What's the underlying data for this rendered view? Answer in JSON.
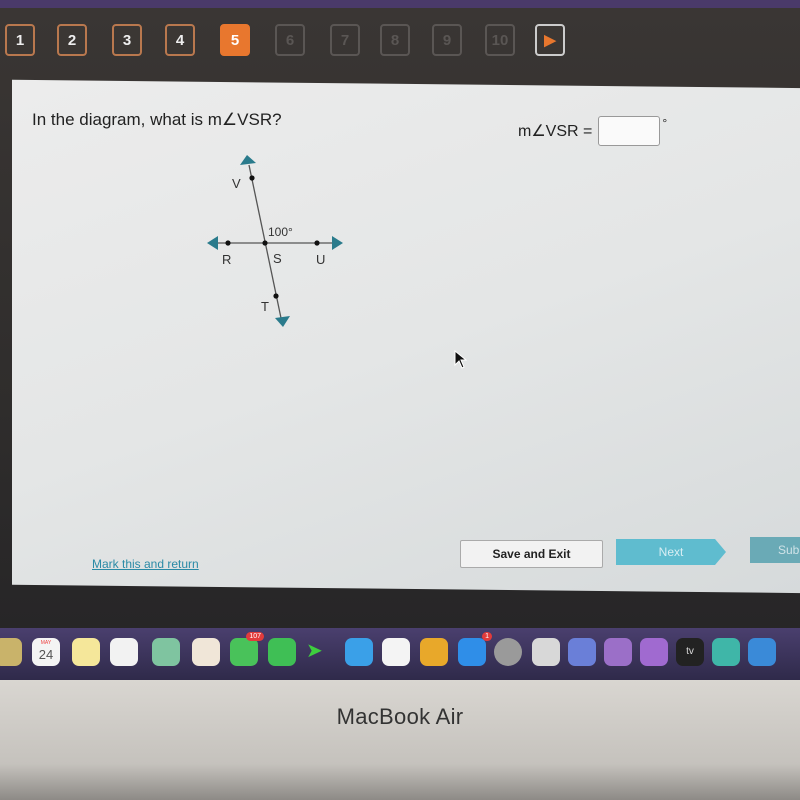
{
  "nav": {
    "questions": [
      {
        "label": "1",
        "state": "answered"
      },
      {
        "label": "2",
        "state": "answered"
      },
      {
        "label": "3",
        "state": "answered"
      },
      {
        "label": "4",
        "state": "answered"
      },
      {
        "label": "5",
        "state": "current"
      },
      {
        "label": "6",
        "state": "disabled"
      },
      {
        "label": "7",
        "state": "disabled"
      },
      {
        "label": "8",
        "state": "disabled"
      },
      {
        "label": "9",
        "state": "disabled"
      },
      {
        "label": "10",
        "state": "disabled"
      }
    ],
    "next_arrow": "▶"
  },
  "question": {
    "text": "In the diagram, what is m∠VSR?",
    "answer_label": "m∠VSR =",
    "answer_value": "",
    "degree": "°"
  },
  "diagram": {
    "points": {
      "V": "V",
      "S": "S",
      "T": "T",
      "R": "R",
      "U": "U"
    },
    "angle_label": "100°"
  },
  "footer": {
    "mark": "Mark this and return",
    "save": "Save and Exit",
    "next": "Next",
    "submit": "Sub"
  },
  "dock": {
    "calendar_day": "24",
    "calendar_month": "MAY",
    "messages_badge": "107",
    "appstore_badge": "1",
    "tv_label": "tv"
  },
  "device": "MacBook Air",
  "colors": {
    "accent": "#e8772e",
    "teal": "#5fbccf",
    "diagram": "#2a7b8c"
  }
}
